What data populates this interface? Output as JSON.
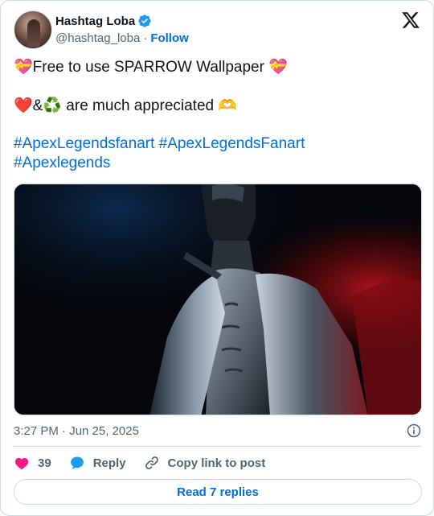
{
  "author": {
    "display_name": "Hashtag Loba",
    "handle": "@hashtag_loba",
    "separator": "·",
    "follow_label": "Follow"
  },
  "post": {
    "line1_emoji_left": "💝",
    "line1_text": "Free to use SPARROW Wallpaper ",
    "line1_emoji_right": "💝",
    "line2_emoji_heart": "❤️",
    "line2_amp": "&",
    "line2_emoji_recycle": "♻️",
    "line2_text": " are much appreciated ",
    "line2_emoji_hands": "🫶",
    "hashtag1": "#ApexLegendsfanart",
    "hashtag2": "#ApexLegendsFanart",
    "hashtag3": "#Apexlegends"
  },
  "meta": {
    "timestamp": "3:27 PM · Jun 25, 2025"
  },
  "actions": {
    "like_count": "39",
    "reply_label": "Reply",
    "copy_label": "Copy link to post"
  },
  "footer": {
    "read_replies_label": "Read 7 replies"
  },
  "colors": {
    "link": "#006fd6",
    "like": "#f91880",
    "verified": "#1d9bf0",
    "reply_icon": "#1d9bf0"
  },
  "icons": {
    "platform": "x-logo-icon",
    "verified": "verified-badge-icon",
    "info": "info-icon",
    "like": "heart-icon",
    "reply": "speech-bubble-icon",
    "copy": "link-icon"
  }
}
